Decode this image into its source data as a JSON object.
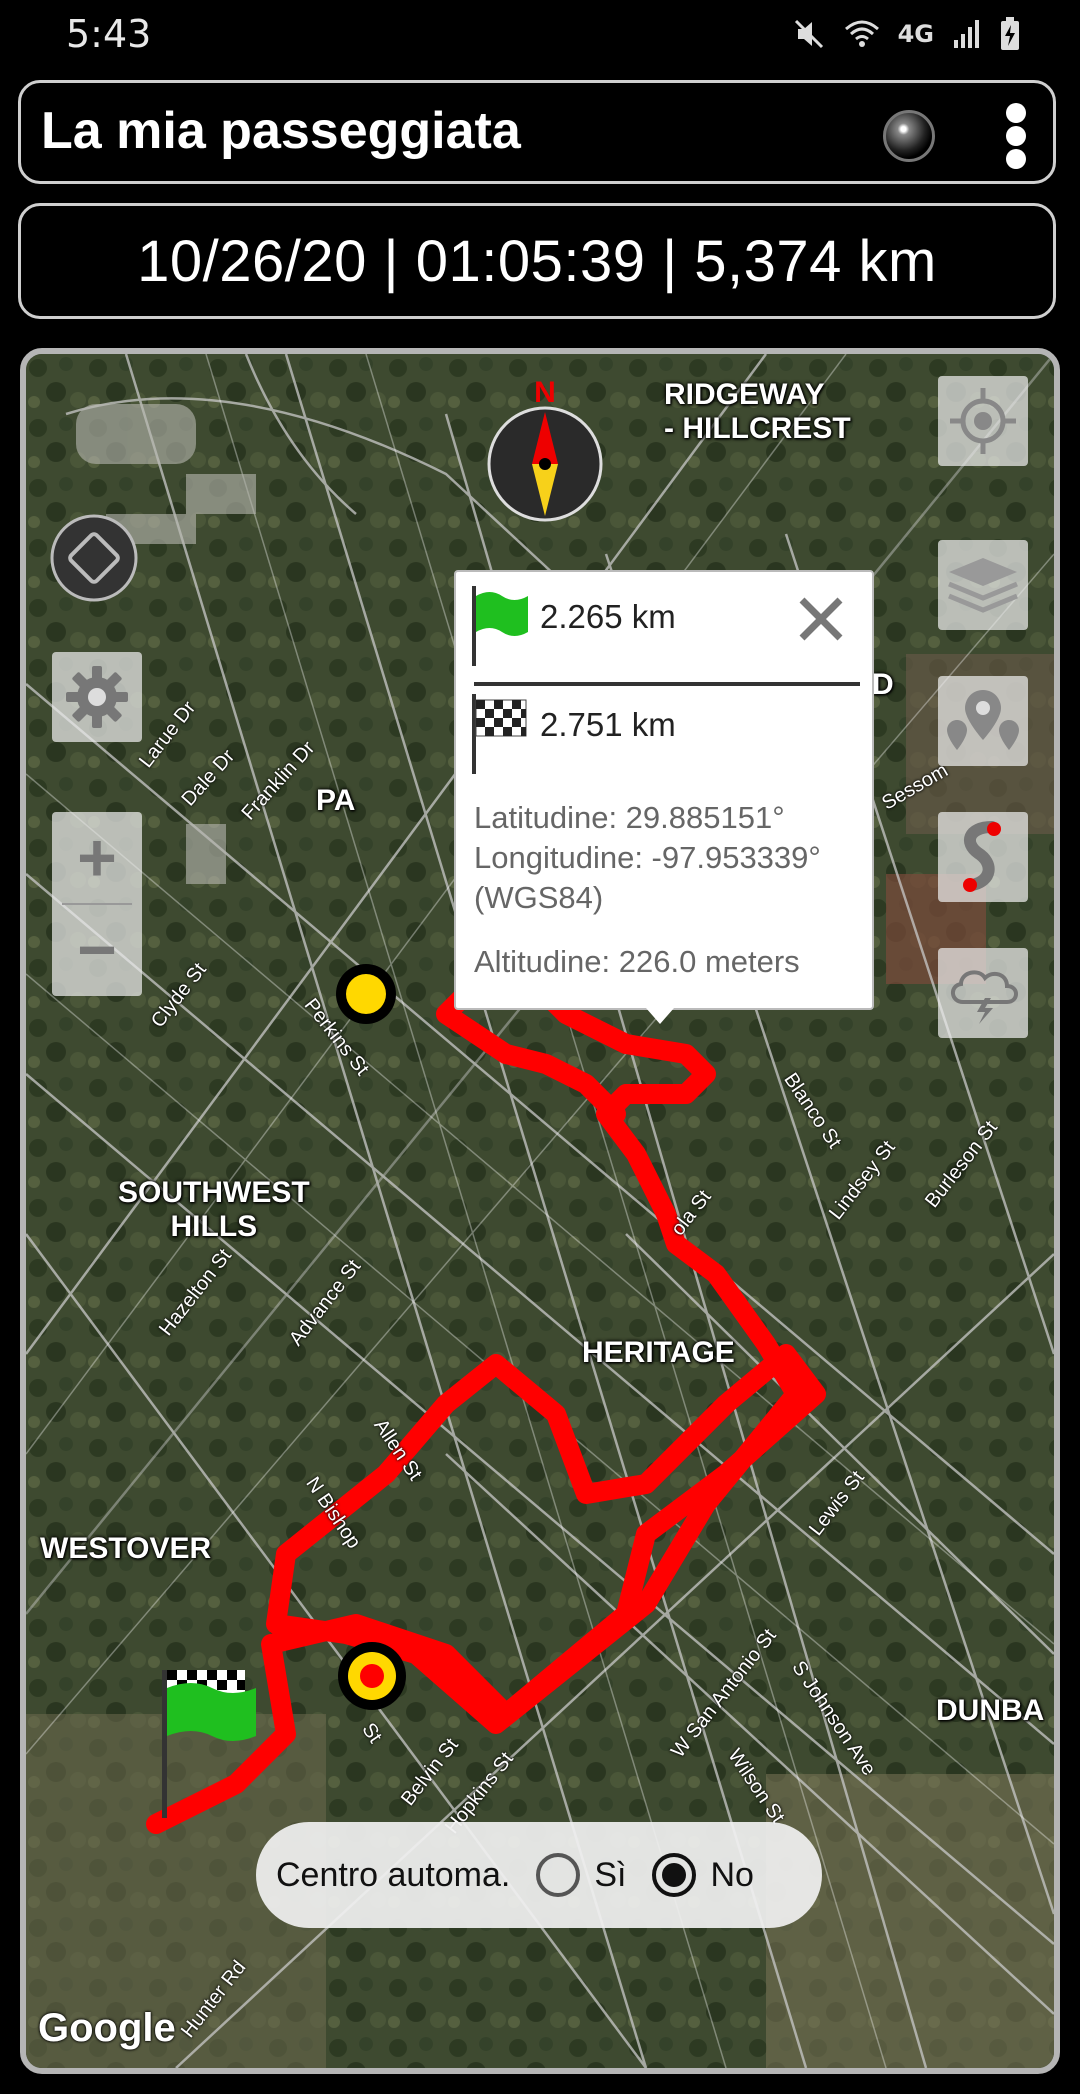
{
  "status_bar": {
    "time": "5:43",
    "network": "4G",
    "icons": [
      "mute-icon",
      "wifi-icon",
      "signal-icon",
      "battery-charging-icon"
    ]
  },
  "header": {
    "title": "La mia passeggiata",
    "record_icon": "record-indicator-icon",
    "menu_icon": "overflow-menu-icon"
  },
  "stats": {
    "text": "10/26/20 | 01:05:39 | 5,374 km"
  },
  "map": {
    "areas": {
      "ridgeway": "RIDGEWAY\n- HILLCREST",
      "southwest_hills": "SOUTHWEST\nHILLS",
      "heritage": "HERITAGE",
      "westover": "WESTOVER",
      "dunbar": "DUNBA",
      "pa": "PA",
      "d": "D"
    },
    "streets": {
      "larue": "Larue Dr",
      "dale": "Dale Dr",
      "franklin": "Franklin Dr",
      "clyde": "Clyde St",
      "perkins": "Perkins St",
      "hazelton": "Hazelton St",
      "advance": "Advance St",
      "allen": "Allen St",
      "nbishop": "N Bishop",
      "st": "St",
      "belvin": "Belvin St",
      "hopkins": "Hopkins St",
      "blanco": "Blanco St",
      "lindsey": "Lindsey St",
      "burleson": "Burleson St",
      "ola": "ola St",
      "lewis": "Lewis St",
      "wsanantonio": "W San Antonio St",
      "sjohnson": "S Johnson Ave",
      "wilson": "Wilson St",
      "hunter": "Hunter Rd",
      "sessom": "Sessom"
    },
    "compass_label": "N",
    "google": "Google",
    "controls": {
      "rotate": "rotate-map-icon",
      "settings": "gear-icon",
      "zoom_in": "+",
      "zoom_out": "−",
      "locate": "my-location-icon",
      "layers": "layers-icon",
      "waypoints": "map-pins-icon",
      "route": "route-icon",
      "weather": "storm-cloud-icon"
    }
  },
  "popup": {
    "start_distance": "2.265 km",
    "finish_distance": "2.751 km",
    "latitude": "Latitudine: 29.885151°",
    "longitude": "Longitudine: -97.953339°",
    "datum": "(WGS84)",
    "altitude": "Altitudine: 226.0 meters"
  },
  "auto_center": {
    "label": "Centro automa.",
    "options": [
      "Sì",
      "No"
    ],
    "selected": "No"
  },
  "colors": {
    "track": "#ff0000",
    "frame": "#b5b5b5",
    "start_flag": "#1fbf1f"
  }
}
